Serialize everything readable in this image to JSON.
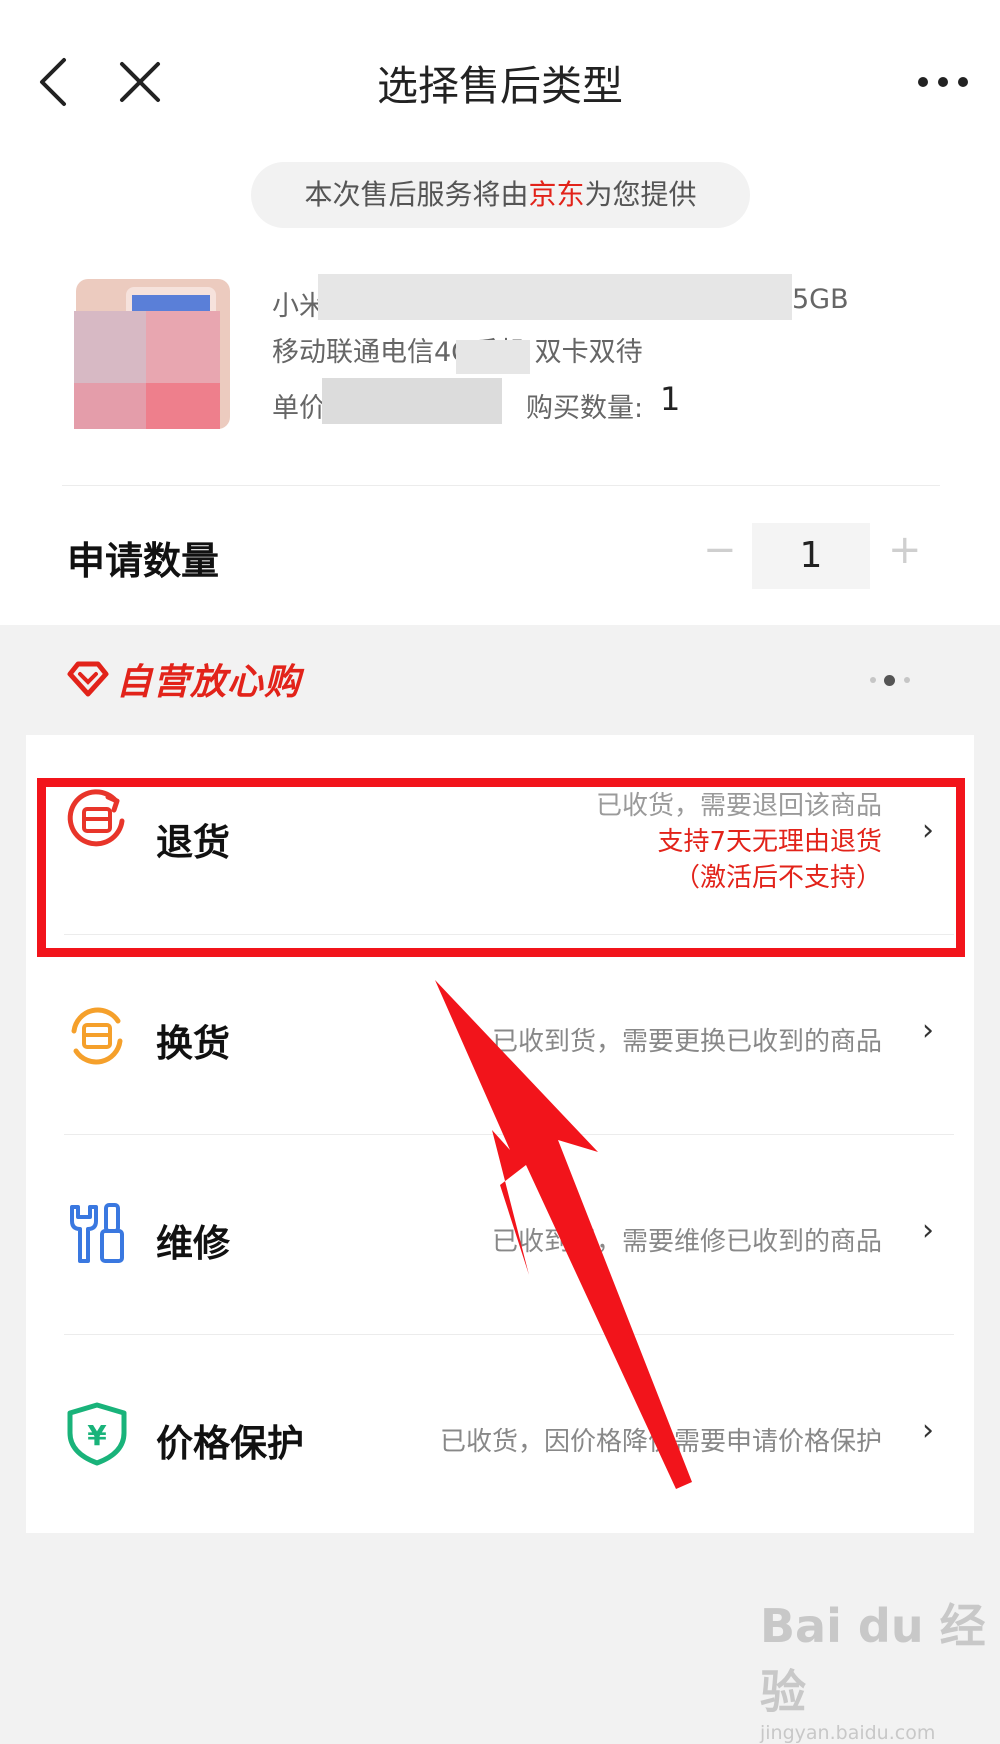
{
  "header": {
    "title": "选择售后类型"
  },
  "provider": {
    "prefix": "本次售后服务将由",
    "brand": "京东",
    "suffix": "为您提供"
  },
  "product": {
    "name_line1_start": "小米",
    "name_line1_end": "5GB",
    "name_line2": "移动联通电信4G手机 双卡双待",
    "price_label": "单价",
    "quantity_label": "购买数量:",
    "quantity_value": "1"
  },
  "apply": {
    "label": "申请数量",
    "value": "1",
    "minus": "−",
    "plus": "+"
  },
  "banner": {
    "title": "自营放心购"
  },
  "options": [
    {
      "name": "退货",
      "desc": "已收货，需要退回该商品",
      "note_line1": "支持7天无理由退货",
      "note_line2": "（激活后不支持）"
    },
    {
      "name": "换货",
      "desc": "已收到货，需要更换已收到的商品"
    },
    {
      "name": "维修",
      "desc": "已收到货，需要维修已收到的商品"
    },
    {
      "name": "价格保护",
      "desc": "已收货，因价格降价需要申请价格保护"
    }
  ],
  "chevron": "›",
  "colors": {
    "accent_red": "#e2231a",
    "return": "#e8352a",
    "exchange": "#f5a02b",
    "repair": "#3a78e0",
    "price": "#19b37a"
  },
  "watermark": {
    "logo": "Bai du 经验",
    "url": "jingyan.baidu.com"
  }
}
